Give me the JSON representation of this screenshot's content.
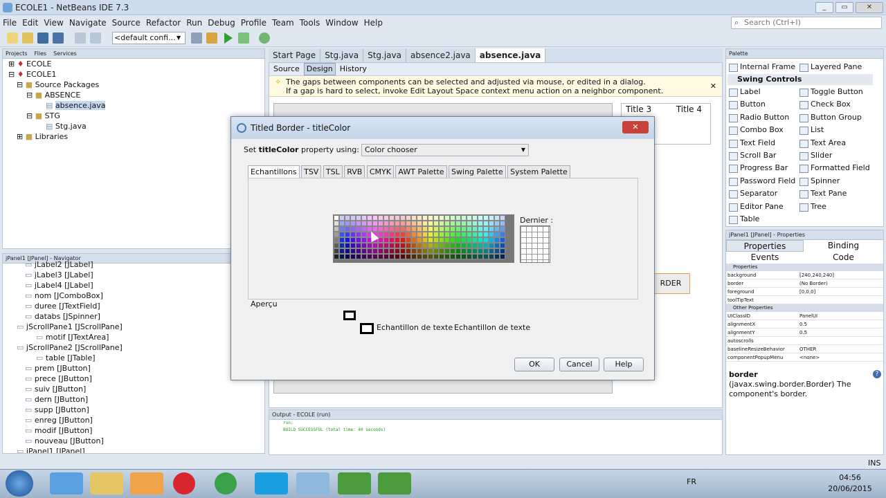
{
  "window": {
    "title": "ECOLE1 - NetBeans IDE 7.3"
  },
  "menu": [
    "File",
    "Edit",
    "View",
    "Navigate",
    "Source",
    "Refactor",
    "Run",
    "Debug",
    "Profile",
    "Team",
    "Tools",
    "Window",
    "Help"
  ],
  "search": {
    "placeholder": "Search (Ctrl+I)"
  },
  "toolbar": {
    "config": "<default confi..."
  },
  "projects": {
    "tabs": [
      "Projects",
      "Files",
      "Services"
    ],
    "tree": [
      "ECOLE",
      "ECOLE1",
      "Source Packages",
      "ABSENCE",
      "absence.java",
      "STG",
      "Stg.java",
      "Libraries"
    ]
  },
  "navigator": {
    "tab": "jPanel1 [JPanel] - Navigator",
    "items": [
      "jLabel2 [JLabel]",
      "jLabel3 [JLabel]",
      "jLabel4 [JLabel]",
      "nom [JComboBox]",
      "duree [JTextField]",
      "databs [JSpinner]",
      "jScrollPane1 [JScrollPane]",
      "motif [JTextArea]",
      "jScrollPane2 [JScrollPane]",
      "table [JTable]",
      "prem [JButton]",
      "prece [JButton]",
      "suiv [JButton]",
      "dern [JButton]",
      "supp [JButton]",
      "enreg [JButton]",
      "modif [JButton]",
      "nouveau [JButton]",
      "jPanel1 [JPanel]"
    ]
  },
  "editor": {
    "tabs": [
      "Start Page",
      "Stg.java",
      "Stg.java",
      "absence2.java",
      "absence.java"
    ],
    "active_tab": "absence.java",
    "modes": [
      "Source",
      "Design",
      "History"
    ],
    "hint_line1": "The gaps between components can be selected and adjusted via mouse, or edited in a dialog.",
    "hint_line2": "If a gap is hard to select, invoke Edit Layout Space context menu action on a neighbor component.",
    "table_headers": [
      "Title 3",
      "Title 4"
    ],
    "bg_button": "RDER"
  },
  "dialog": {
    "title": "Titled Border - titleColor",
    "set_prefix": "Set",
    "set_bold": "titleColor",
    "set_suffix": "property using:",
    "mode": "Color chooser",
    "tabs": [
      "Echantillons",
      "TSV",
      "TSL",
      "RVB",
      "CMYK",
      "AWT Palette",
      "Swing Palette",
      "System Palette"
    ],
    "recent_label": "Dernier :",
    "preview_label": "Aperçu",
    "sample_text_1": "Echantillon de texte",
    "sample_text_2": "Echantillon de texte",
    "buttons": {
      "ok": "OK",
      "cancel": "Cancel",
      "help": "Help"
    }
  },
  "palette": {
    "title": "Palette",
    "top": [
      "Internal Frame",
      "Layered Pane"
    ],
    "section": "Swing Controls",
    "items": [
      "Label",
      "Toggle Button",
      "Button",
      "Check Box",
      "Radio Button",
      "Button Group",
      "Combo Box",
      "List",
      "Text Field",
      "Text Area",
      "Scroll Bar",
      "Slider",
      "Progress Bar",
      "Formatted Field",
      "Password Field",
      "Spinner",
      "Separator",
      "Text Pane",
      "Editor Pane",
      "Tree",
      "Table"
    ]
  },
  "properties": {
    "title": "jPanel1 [JPanel] - Properties",
    "tabs": [
      "Properties",
      "Binding",
      "Events",
      "Code"
    ],
    "section1": "Properties",
    "rows1": [
      [
        "background",
        "[240,240,240]"
      ],
      [
        "border",
        "(No Border)"
      ],
      [
        "foreground",
        "[0,0,0]"
      ],
      [
        "toolTipText",
        ""
      ]
    ],
    "section2": "Other Properties",
    "rows2": [
      [
        "UIClassID",
        "PanelUI"
      ],
      [
        "alignmentX",
        "0.5"
      ],
      [
        "alignmentY",
        "0.5"
      ],
      [
        "autoscrolls",
        ""
      ],
      [
        "baselineResizeBehavior",
        "OTHER"
      ],
      [
        "componentPopupMenu",
        "<none>"
      ]
    ],
    "desc_title": "border",
    "desc_text": "(javax.swing.border.Border) The component's border."
  },
  "output": {
    "tab": "Output - ECOLE (run)",
    "line1": "run:",
    "line2": "BUILD SUCCESSFUL (total time: 40 seconds)"
  },
  "status": {
    "mode": "INS"
  },
  "taskbar": {
    "lang": "FR",
    "time": "04:56",
    "date": "20/06/2015"
  }
}
